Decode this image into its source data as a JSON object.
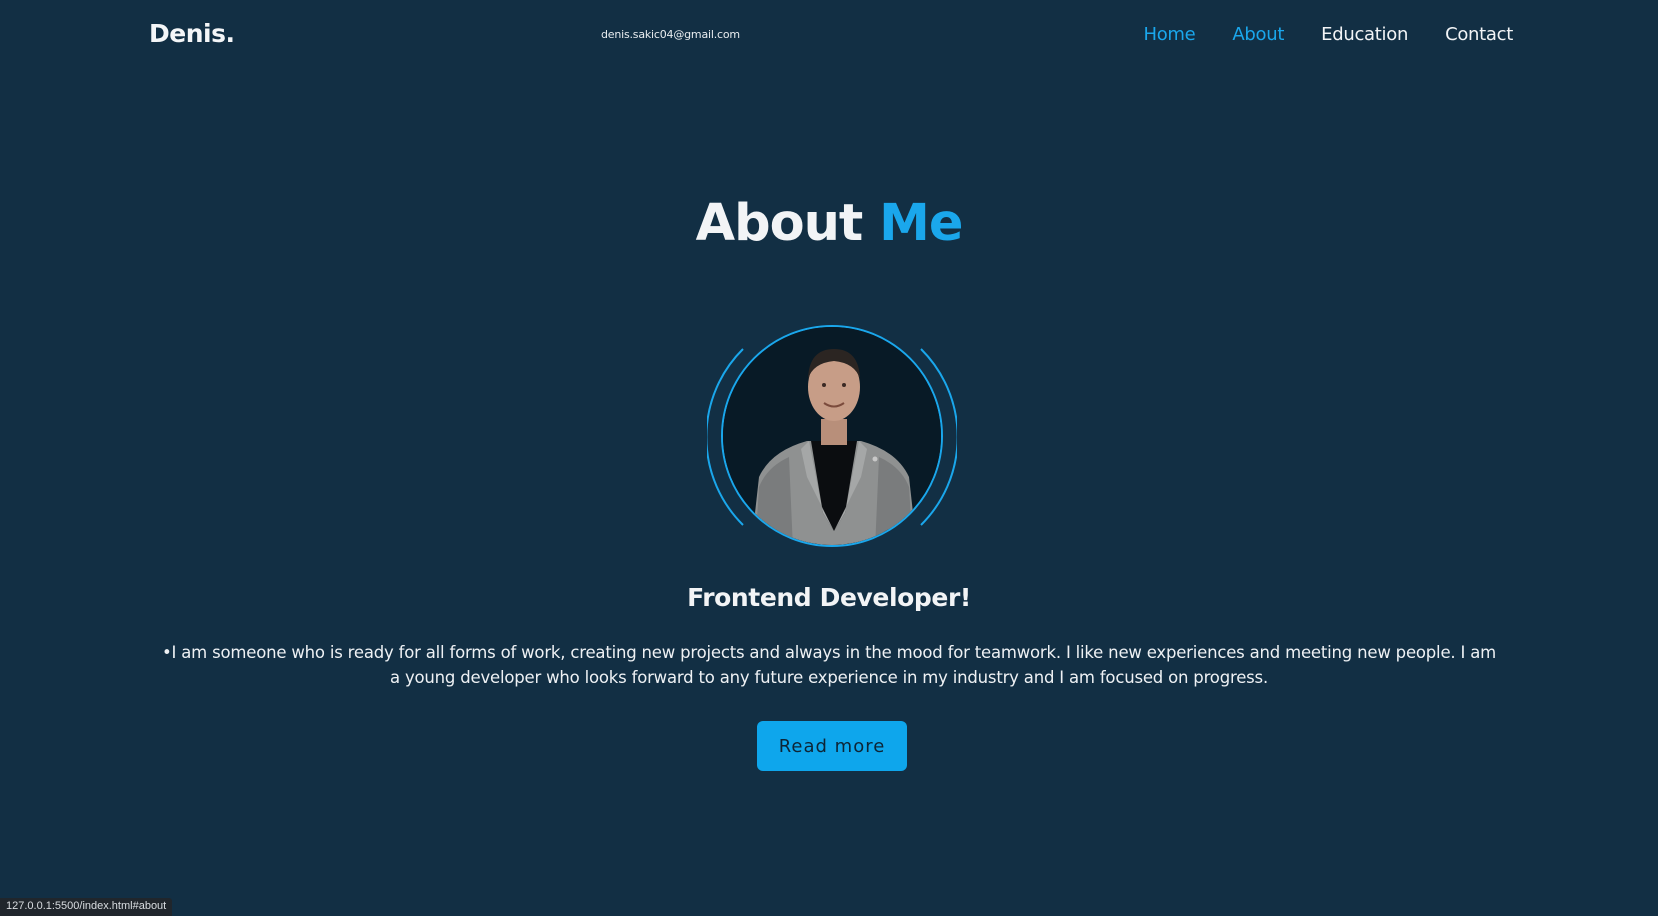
{
  "header": {
    "logo": "Denis.",
    "email": "denis.sakic04@gmail.com",
    "nav": [
      {
        "label": "Home"
      },
      {
        "label": "About"
      },
      {
        "label": "Education"
      },
      {
        "label": "Contact"
      }
    ]
  },
  "about": {
    "title_main": "About",
    "title_accent": "Me",
    "role": "Frontend Developer!",
    "description": "•I am someone who is ready for all forms of work, creating new projects and always in the mood for teamwork. I like new experiences and meeting new people. I am a young developer who looks forward to any future experience in my industry and I am focused on progress.",
    "button_label": "Read more"
  },
  "status_bar": {
    "url": "127.0.0.1:5500/index.html#about"
  },
  "colors": {
    "background": "#122f44",
    "accent": "#1aa7ec",
    "button": "#0ea6ec",
    "text": "#f2f4f6"
  }
}
